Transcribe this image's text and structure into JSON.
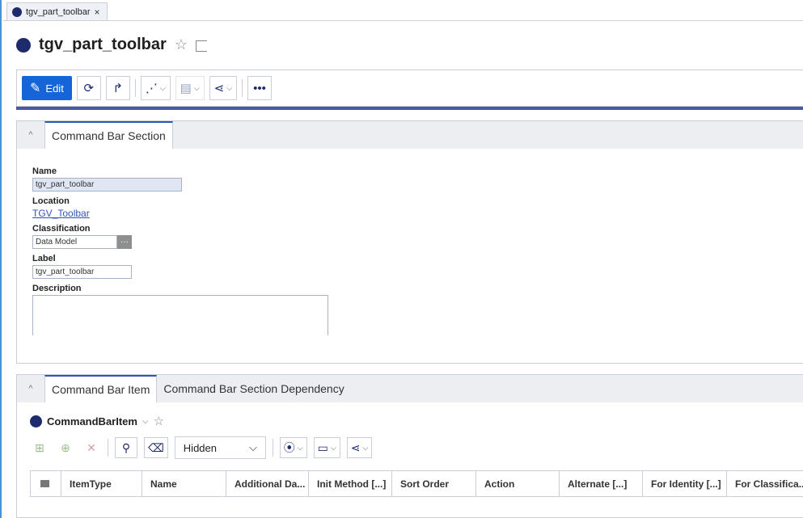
{
  "tab": {
    "label": "tgv_part_toolbar",
    "close": "×"
  },
  "header": {
    "title": "tgv_part_toolbar"
  },
  "toolbar": {
    "edit_label": "Edit",
    "more_label": "•••"
  },
  "section1": {
    "collapse_glyph": "^",
    "tabs": [
      "Command Bar Section"
    ],
    "fields": {
      "name_label": "Name",
      "name_value": "tgv_part_toolbar",
      "location_label": "Location",
      "location_value": "TGV_Toolbar",
      "classification_label": "Classification",
      "classification_value": "Data Model",
      "classification_button": "···",
      "label_label": "Label",
      "label_value": "tgv_part_toolbar",
      "description_label": "Description",
      "description_value": ""
    }
  },
  "section2": {
    "collapse_glyph": "^",
    "tabs": [
      "Command Bar Item",
      "Command Bar Section Dependency"
    ],
    "grid_title": "CommandBarItem",
    "filter_select": "Hidden",
    "columns": [
      "ItemType",
      "Name",
      "Additional Da...",
      "Init Method [...]",
      "Sort Order",
      "Action",
      "Alternate [...]",
      "For Identity [...]",
      "For Classifica..."
    ]
  },
  "colors": {
    "accent": "#1565d8",
    "brand_dark": "#1d2a6b",
    "frame": "#4a90d9"
  }
}
